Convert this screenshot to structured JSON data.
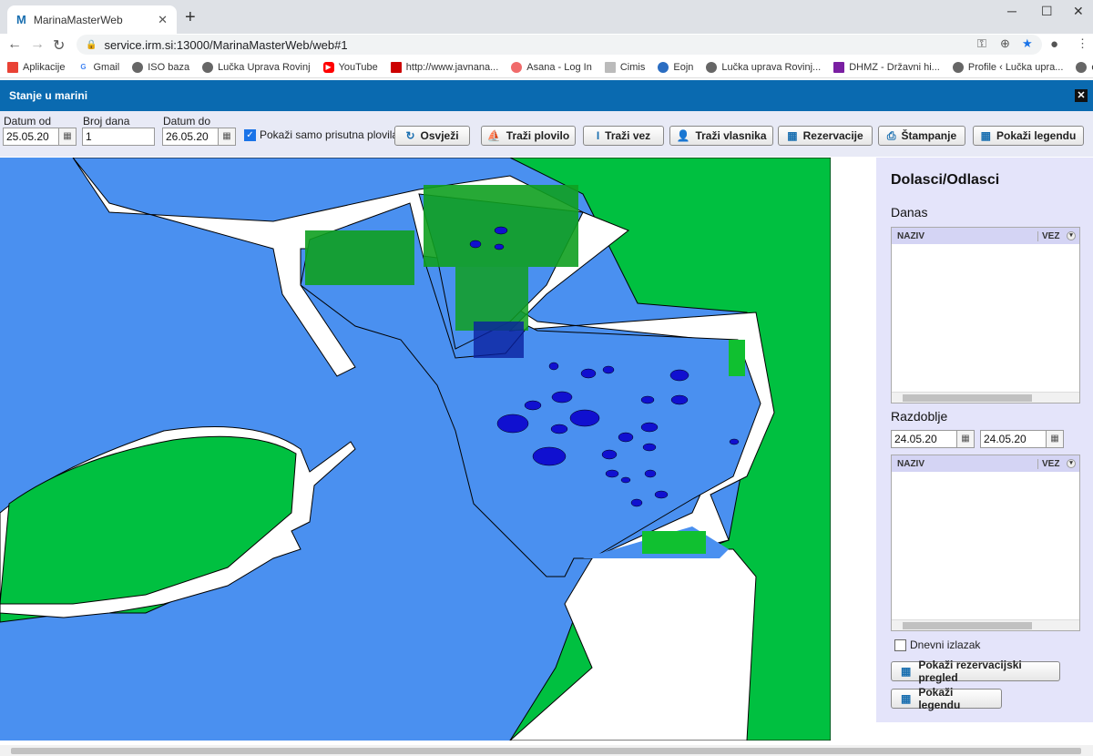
{
  "browser": {
    "tab_title": "MarinaMasterWeb",
    "url": "service.irm.si:13000/MarinaMasterWeb/web#1",
    "bookmarks": [
      "Aplikacije",
      "Gmail",
      "ISO baza",
      "Lučka Uprava Rovinj",
      "YouTube",
      "http://www.javnana...",
      "Asana - Log In",
      "Cimis",
      "Eojn",
      "Lučka uprava Rovinj...",
      "DHMZ - Državni hi...",
      "Profile ‹ Lučka upra...",
      "ePlovilo"
    ]
  },
  "header": {
    "title": "Stanje u marini",
    "close": "✕"
  },
  "controls": {
    "datum_od_label": "Datum od",
    "datum_od": "25.05.20",
    "broj_dana_label": "Broj dana",
    "broj_dana": "1",
    "datum_do_label": "Datum do",
    "datum_do": "26.05.20",
    "samo_prisutna": "Pokaži samo prisutna plovila",
    "buttons": {
      "osvjezi": "Osvježi",
      "trazi_plovilo": "Traži plovilo",
      "trazi_vez": "Traži vez",
      "trazi_vlasnika": "Traži vlasnika",
      "rezervacije": "Rezervacije",
      "stampanje": "Štampanje",
      "pokazi_legendu": "Pokaži legendu"
    }
  },
  "side": {
    "title": "Dolasci/Odlasci",
    "danas": "Danas",
    "col_naziv": "NAZIV",
    "col_vez": "VEZ",
    "razdoblje": "Razdoblje",
    "raz_od": "24.05.20",
    "raz_do": "24.05.20",
    "dnevni": "Dnevni izlazak",
    "btn_pregled": "Pokaži rezervacijski pregled",
    "btn_legenda": "Pokaži legendu"
  },
  "colors": {
    "sea": "#4a90f0",
    "land": "#00c040",
    "pier": "#ffffff",
    "header": "#0a6ab0"
  }
}
